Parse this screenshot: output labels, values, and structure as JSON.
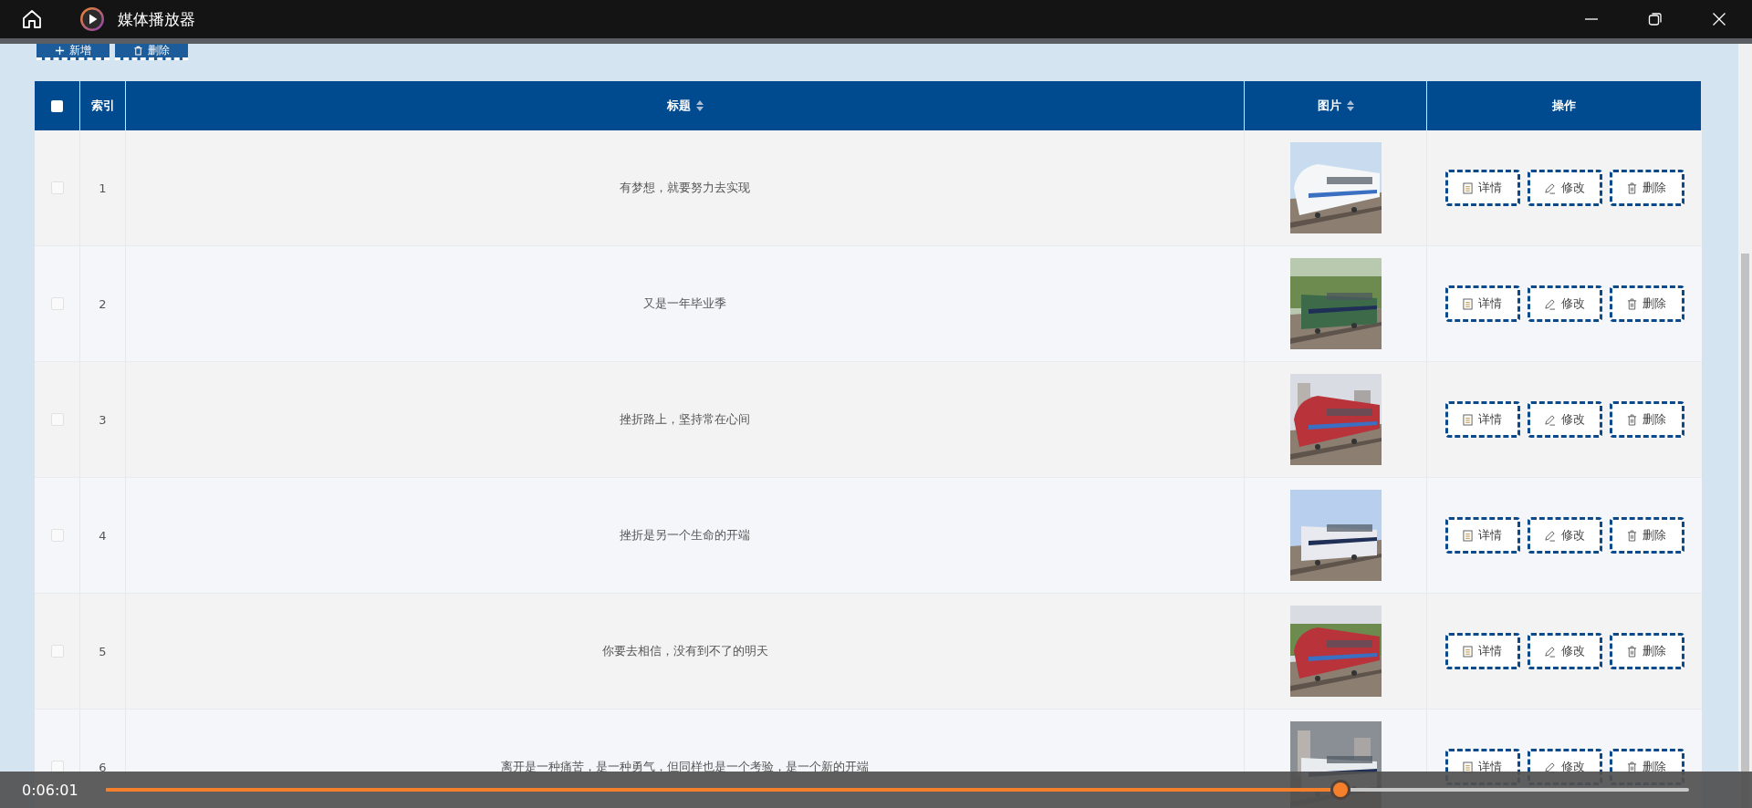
{
  "window": {
    "title": "媒体播放器"
  },
  "toolbar": [
    {
      "label": "新增",
      "kind": "add"
    },
    {
      "label": "删除",
      "kind": "delete"
    }
  ],
  "table": {
    "header_checkbox": {
      "checked": false
    },
    "columns": [
      {
        "label": "索引",
        "sortable": false
      },
      {
        "label": "标题",
        "sortable": true
      },
      {
        "label": "图片",
        "sortable": true
      },
      {
        "label": "操作",
        "sortable": false
      }
    ],
    "rows": [
      {
        "checked": false,
        "index": "1",
        "title": "有梦想，就要努力去实现",
        "actions": [
          {
            "label": "详情",
            "kind": "detail"
          },
          {
            "label": "修改",
            "kind": "edit"
          },
          {
            "label": "删除",
            "kind": "delete"
          }
        ]
      },
      {
        "checked": false,
        "index": "2",
        "title": "又是一年毕业季",
        "actions": [
          {
            "label": "详情",
            "kind": "detail"
          },
          {
            "label": "修改",
            "kind": "edit"
          },
          {
            "label": "删除",
            "kind": "delete"
          }
        ]
      },
      {
        "checked": false,
        "index": "3",
        "title": "挫折路上，坚持常在心间",
        "actions": [
          {
            "label": "详情",
            "kind": "detail"
          },
          {
            "label": "修改",
            "kind": "edit"
          },
          {
            "label": "删除",
            "kind": "delete"
          }
        ]
      },
      {
        "checked": false,
        "index": "4",
        "title": "挫折是另一个生命的开端",
        "actions": [
          {
            "label": "详情",
            "kind": "detail"
          },
          {
            "label": "修改",
            "kind": "edit"
          },
          {
            "label": "删除",
            "kind": "delete"
          }
        ]
      },
      {
        "checked": false,
        "index": "5",
        "title": "你要去相信，没有到不了的明天",
        "actions": [
          {
            "label": "详情",
            "kind": "detail"
          },
          {
            "label": "修改",
            "kind": "edit"
          },
          {
            "label": "删除",
            "kind": "delete"
          }
        ]
      },
      {
        "checked": false,
        "index": "6",
        "title": "离开是一种痛苦，是一种勇气，但同样也是一个考验，是一个新的开端",
        "actions": [
          {
            "label": "详情",
            "kind": "detail"
          },
          {
            "label": "修改",
            "kind": "edit"
          },
          {
            "label": "删除",
            "kind": "delete"
          }
        ]
      }
    ]
  },
  "player": {
    "time": "0:06:01",
    "level": 0.78
  }
}
